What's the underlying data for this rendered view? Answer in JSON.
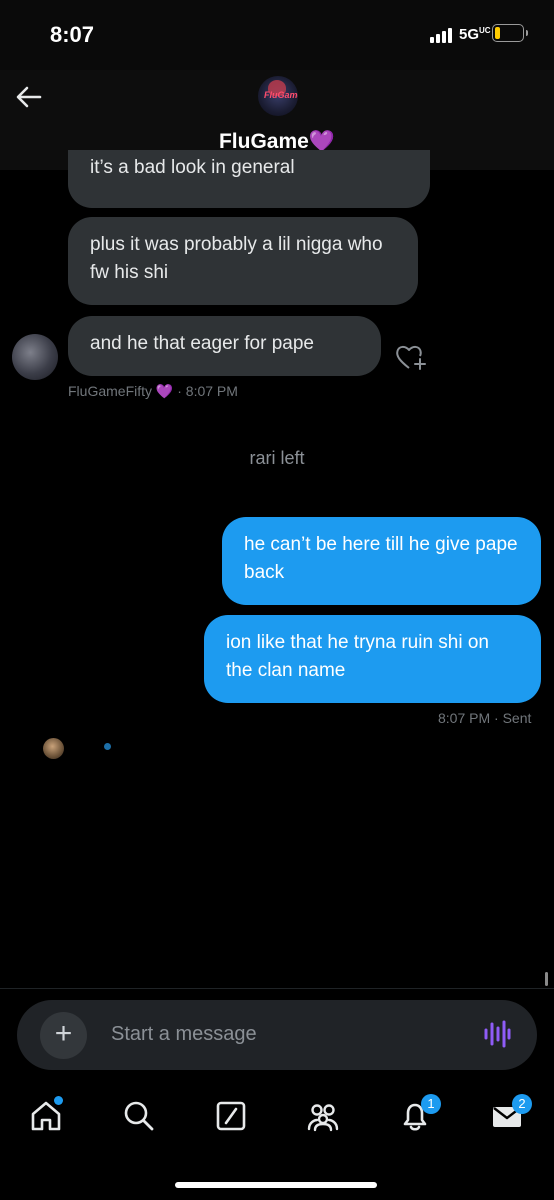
{
  "status_bar": {
    "time": "8:07",
    "network": "5G",
    "network_sub": "UC"
  },
  "header": {
    "name": "FluGame",
    "name_emoji": "💜",
    "avatar_text": "FluGame"
  },
  "messages": {
    "m1": "it’s a bad look in general",
    "m2": "plus it was probably a lil nigga who fw his shi",
    "m3": "and he that eager for pape",
    "sender_meta": {
      "name": "FluGameFifty",
      "emoji": "💜",
      "time": "· 8:07 PM"
    },
    "system": "rari left",
    "m4": "he can’t be here till he give pape back",
    "m5": "ion like that he tryna ruin shi on the clan name",
    "sent_meta": "8:07 PM · Sent"
  },
  "composer": {
    "placeholder": "Start a message",
    "plus": "+"
  },
  "tabs": {
    "notifications_badge": "1",
    "messages_badge": "2"
  },
  "colors": {
    "accent": "#1d9bf0",
    "incoming": "#2f3336",
    "background": "#000000",
    "purple_heart": "#a94be0"
  }
}
